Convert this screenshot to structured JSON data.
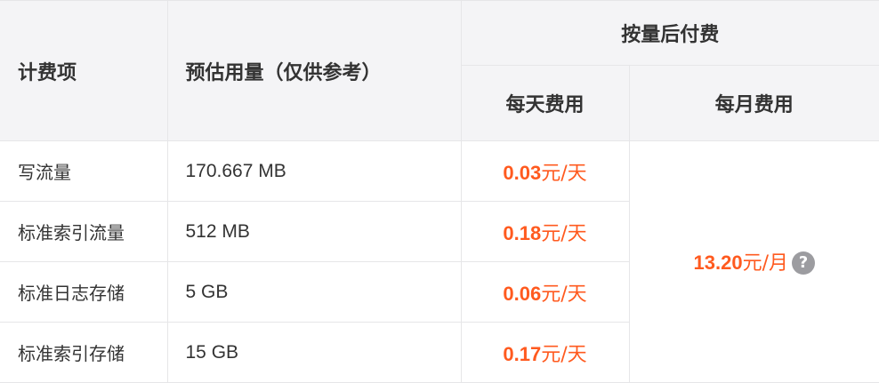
{
  "header": {
    "item": "计费项",
    "usage": "预估用量（仅供参考）",
    "pay_as_you_go": "按量后付费",
    "daily_cost": "每天费用",
    "monthly_cost": "每月费用"
  },
  "rows": [
    {
      "item": "写流量",
      "usage": "170.667 MB",
      "daily_value": "0.03",
      "daily_unit": "元/天"
    },
    {
      "item": "标准索引流量",
      "usage": "512 MB",
      "daily_value": "0.18",
      "daily_unit": "元/天"
    },
    {
      "item": "标准日志存储",
      "usage": "5 GB",
      "daily_value": "0.06",
      "daily_unit": "元/天"
    },
    {
      "item": "标准索引存储",
      "usage": "15 GB",
      "daily_value": "0.17",
      "daily_unit": "元/天"
    }
  ],
  "monthly": {
    "value": "13.20",
    "unit": "元/月",
    "help_icon": "question-circle-icon"
  },
  "colors": {
    "price_accent": "#ff5a1f",
    "header_bg": "#f4f4f6",
    "border": "#e6e6e8",
    "help_icon_bg": "#9c9ca0"
  }
}
